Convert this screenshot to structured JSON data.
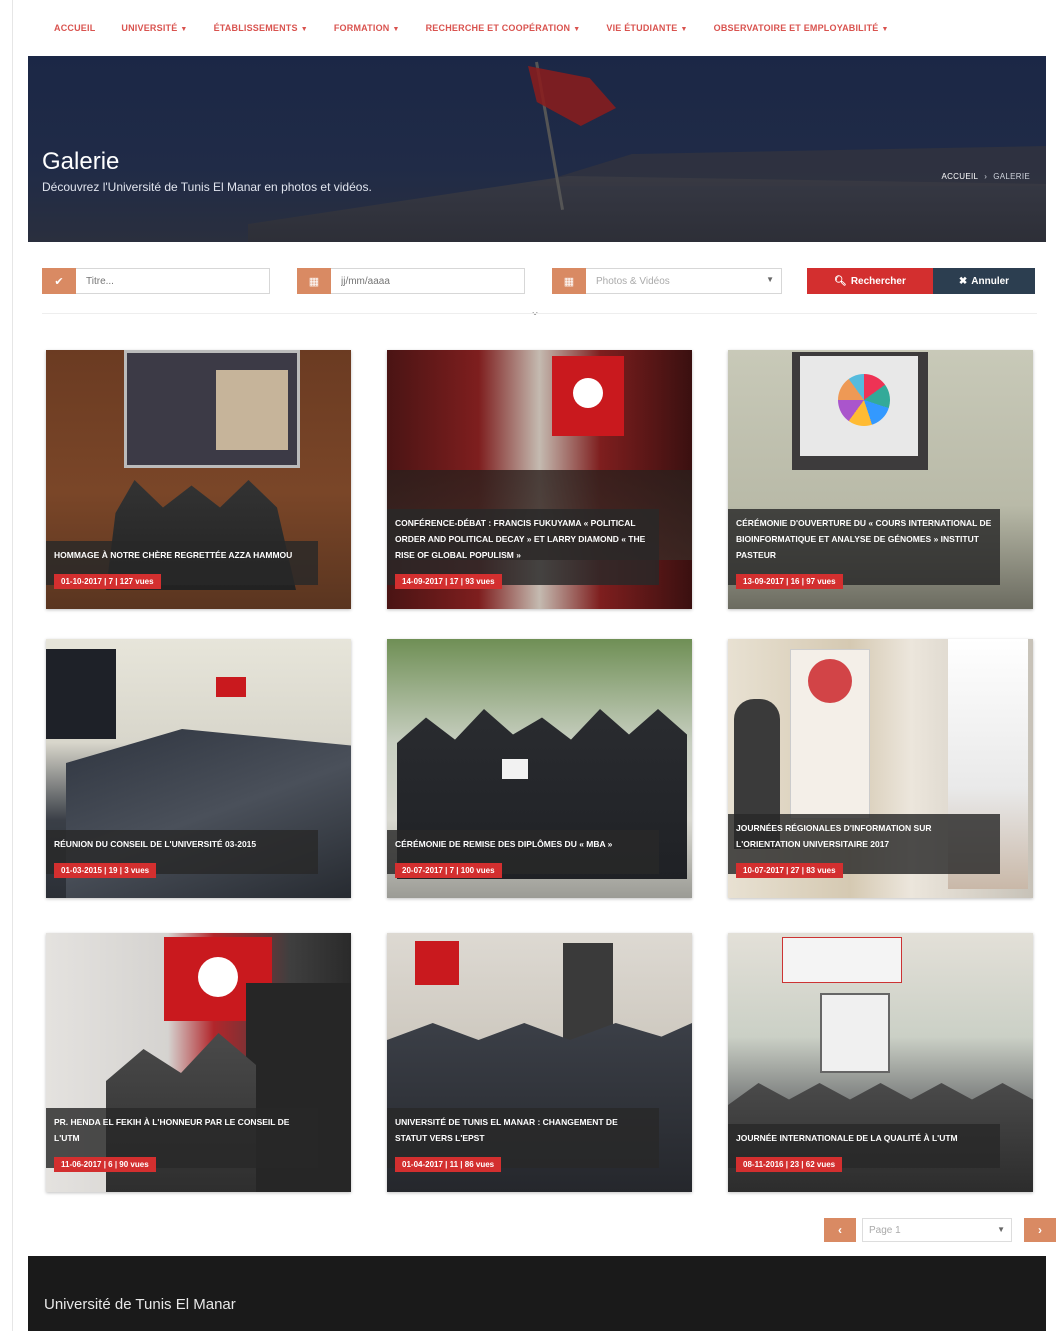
{
  "nav": {
    "items": [
      {
        "label": "ACCUEIL",
        "caret": false
      },
      {
        "label": "UNIVERSITÉ",
        "caret": true
      },
      {
        "label": "ÉTABLISSEMENTS",
        "caret": true
      },
      {
        "label": "FORMATION",
        "caret": true
      },
      {
        "label": "RECHERCHE ET COOPÉRATION",
        "caret": true
      },
      {
        "label": "VIE ÉTUDIANTE",
        "caret": true
      },
      {
        "label": "OBSERVATOIRE ET EMPLOYABILITÉ",
        "caret": true
      }
    ]
  },
  "hero": {
    "title": "Galerie",
    "subtitle": "Découvrez l'Université de Tunis El Manar en photos et vidéos.",
    "breadcrumb_home": "ACCUEIL",
    "breadcrumb_sep": "›",
    "breadcrumb_current": "GALERIE"
  },
  "filters": {
    "title_placeholder": "Titre...",
    "date_placeholder": "jj/mm/aaaa",
    "type_value": "Photos & Vidéos",
    "search_label": "Rechercher",
    "cancel_label": "Annuler",
    "icons": {
      "title": "check-icon",
      "date": "calendar-icon",
      "type": "calendar-icon",
      "search": "search-icon",
      "cancel": "close-icon"
    }
  },
  "gallery": [
    {
      "title": "HOMMAGE À NOTRE CHÈRE REGRETTÉE AZZA HAMMOU",
      "meta": "01-10-2017 | 7 | 127 vues"
    },
    {
      "title": "CONFÉRENCE-DÉBAT : FRANCIS FUKUYAMA « POLITICAL ORDER AND POLITICAL DECAY » ET LARRY DIAMOND « THE RISE OF GLOBAL POPULISM »",
      "meta": "14-09-2017 | 17 | 93 vues"
    },
    {
      "title": "CÉRÉMONIE D'OUVERTURE DU « COURS INTERNATIONAL DE BIOINFORMATIQUE ET ANALYSE DE GÉNOMES » INSTITUT PASTEUR",
      "meta": "13-09-2017 | 16 | 97 vues"
    },
    {
      "title": "RÉUNION DU CONSEIL DE L'UNIVERSITÉ 03-2015",
      "meta": "01-03-2015 | 19 | 3 vues"
    },
    {
      "title": "CÉRÉMONIE DE REMISE DES DIPLÔMES DU « MBA »",
      "meta": "20-07-2017 | 7 | 100 vues"
    },
    {
      "title": "JOURNÉES RÉGIONALES D'INFORMATION SUR L'ORIENTATION UNIVERSITAIRE 2017",
      "meta": "10-07-2017 | 27 | 83 vues"
    },
    {
      "title": "PR. HENDA EL FEKIH À L'HONNEUR PAR LE CONSEIL DE L'UTM",
      "meta": "11-06-2017 | 6 | 90 vues"
    },
    {
      "title": "UNIVERSITÉ DE TUNIS EL MANAR : CHANGEMENT DE STATUT VERS L'EPST",
      "meta": "01-04-2017 | 11 | 86 vues"
    },
    {
      "title": "JOURNÉE INTERNATIONALE DE LA QUALITÉ À L'UTM",
      "meta": "08-11-2016 | 23 | 62 vues"
    }
  ],
  "pagination": {
    "prev": "‹",
    "next": "›",
    "page_label": "Page 1"
  },
  "footer": {
    "title": "Université de Tunis El Manar"
  },
  "colors": {
    "accent": "#d32f2f",
    "accent_soft": "#d98a63",
    "dark": "#2c3e50",
    "footer": "#1a1a1a"
  }
}
